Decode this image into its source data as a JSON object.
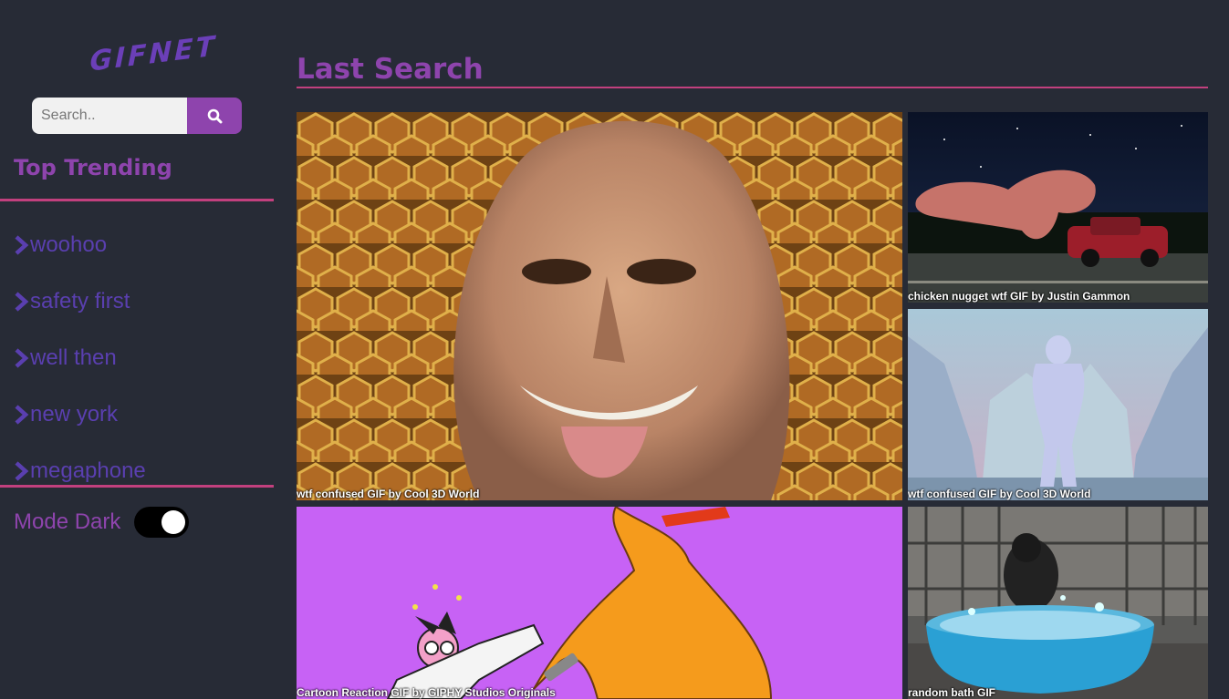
{
  "sidebar": {
    "logo": "GIFNET",
    "search": {
      "placeholder": "Search..",
      "value": ""
    },
    "trending_title": "Top Trending",
    "trending": [
      "woohoo",
      "safety first",
      "well then",
      "new york",
      "megaphone"
    ],
    "mode_label": "Mode Dark",
    "dark_mode_on": true
  },
  "main": {
    "title": "Last Search",
    "gifs": [
      {
        "caption": "wtf confused GIF by Cool 3D World"
      },
      {
        "caption": "chicken nugget wtf GIF by Justin Gammon"
      },
      {
        "caption": "wtf confused GIF by Cool 3D World"
      },
      {
        "caption": "Cartoon Reaction GIF by GIPHY Studios Originals"
      },
      {
        "caption": "random bath GIF"
      }
    ]
  },
  "colors": {
    "background": "#272b36",
    "accent": "#8e44ad",
    "divider": "#c2407e",
    "link": "#5a3fb0"
  },
  "icons": [
    "search-icon",
    "chevron-right-icon"
  ]
}
